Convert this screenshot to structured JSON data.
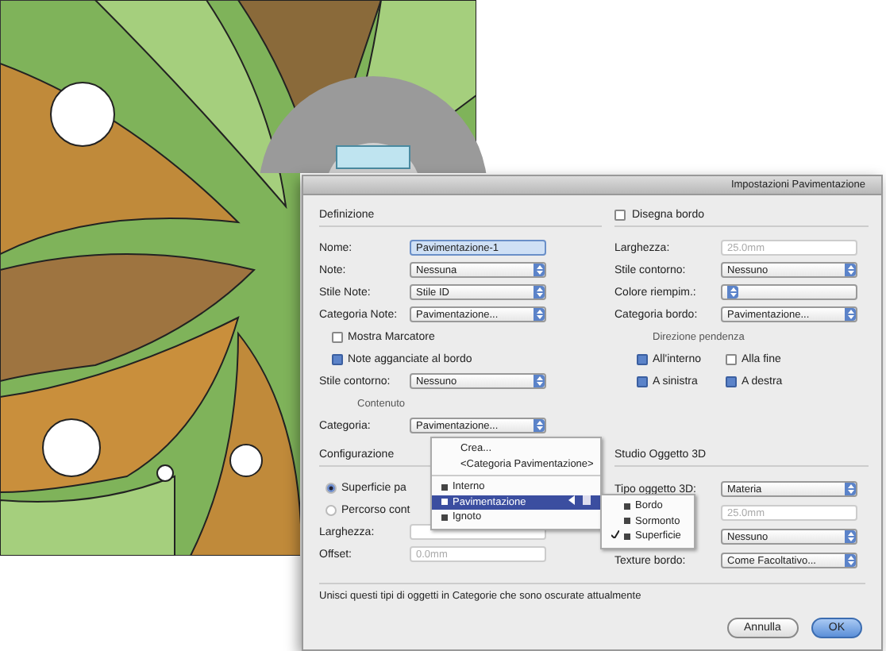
{
  "dialog": {
    "title": "Impostazioni Pavimentazione",
    "left_section": {
      "heading": "Definizione",
      "rows": [
        {
          "kind": "text",
          "label": "Nome:",
          "value": "Pavimentazione-1",
          "disabled": false
        },
        {
          "kind": "select",
          "label": "Note:",
          "value": "Nessuna"
        },
        {
          "kind": "select",
          "label": "Stile Note:",
          "value": "Stile ID"
        },
        {
          "kind": "select",
          "label": "Categoria Note:",
          "value": "Pavimentazione..."
        },
        {
          "kind": "check",
          "label": "Mostra Marcatore",
          "checked": false
        },
        {
          "kind": "check",
          "label": "Note agganciate al bordo",
          "checked": true
        },
        {
          "kind": "select",
          "label": "Stile contorno:",
          "value": "Nessuno"
        },
        {
          "kind": "caption",
          "label": "Contenuto"
        },
        {
          "kind": "select",
          "label": "Categoria:",
          "value": "Pavimentazione..."
        }
      ]
    },
    "border_section": {
      "heading": "Disegna bordo",
      "checked": false,
      "rows": [
        {
          "kind": "text",
          "label": "Larghezza:",
          "value": "25.0mm",
          "disabled": true
        },
        {
          "kind": "select",
          "label": "Stile contorno:",
          "value": "Nessuno"
        },
        {
          "kind": "select",
          "label": "Colore riempim.:"
        },
        {
          "kind": "select",
          "label": "Categoria bordo:",
          "value": "Pavimentazione..."
        },
        {
          "kind": "caption",
          "label": "Direzione pendenza"
        }
      ],
      "options": [
        {
          "label": "All'interno",
          "checked": true
        },
        {
          "label": "Alla fine",
          "checked": false
        },
        {
          "label": "A sinistra",
          "checked": true
        },
        {
          "label": "A destra",
          "checked": true
        }
      ]
    },
    "config_section": {
      "heading": "Configurazione",
      "rows": [
        {
          "kind": "radio",
          "label": "Superficie pa",
          "selected": true
        },
        {
          "kind": "radio",
          "label": "Percorso cont",
          "selected": false
        },
        {
          "kind": "text",
          "label": "Larghezza:",
          "disabled": true
        },
        {
          "kind": "text",
          "label": "Offset:",
          "value": "0.0mm",
          "disabled": true
        }
      ]
    },
    "object3d_section": {
      "heading": "Studio Oggetto 3D",
      "rows": [
        {
          "kind": "select",
          "label": "Tipo oggetto 3D:",
          "value": "Materia"
        },
        {
          "kind": "text",
          "value": "25.0mm",
          "disabled": true
        },
        {
          "kind": "select",
          "value": "Nessuno"
        },
        {
          "kind": "select",
          "label": "Texture bordo:",
          "value": "Come Facoltativo..."
        }
      ]
    },
    "note": "Unisci questi tipi di oggetti in Categorie che sono oscurate attualmente",
    "buttons": [
      {
        "label": "Annulla",
        "default": false
      },
      {
        "label": "OK",
        "default": true
      }
    ]
  },
  "category_menu": {
    "items": [
      {
        "label": "Crea...",
        "kind": "command",
        "selected": false
      },
      {
        "label": "<Categoria Pavimentazione>",
        "kind": "command",
        "selected": false
      },
      {
        "label": "Interno",
        "kind": "category",
        "selected": false
      },
      {
        "label": "Pavimentazione",
        "kind": "category",
        "selected": true
      },
      {
        "label": "Ignoto",
        "kind": "category",
        "selected": false
      }
    ]
  },
  "type_menu": {
    "items": [
      {
        "label": "Bordo",
        "checked": false
      },
      {
        "label": "Sormonto",
        "checked": false
      },
      {
        "label": "Superficie",
        "checked": true
      }
    ]
  }
}
